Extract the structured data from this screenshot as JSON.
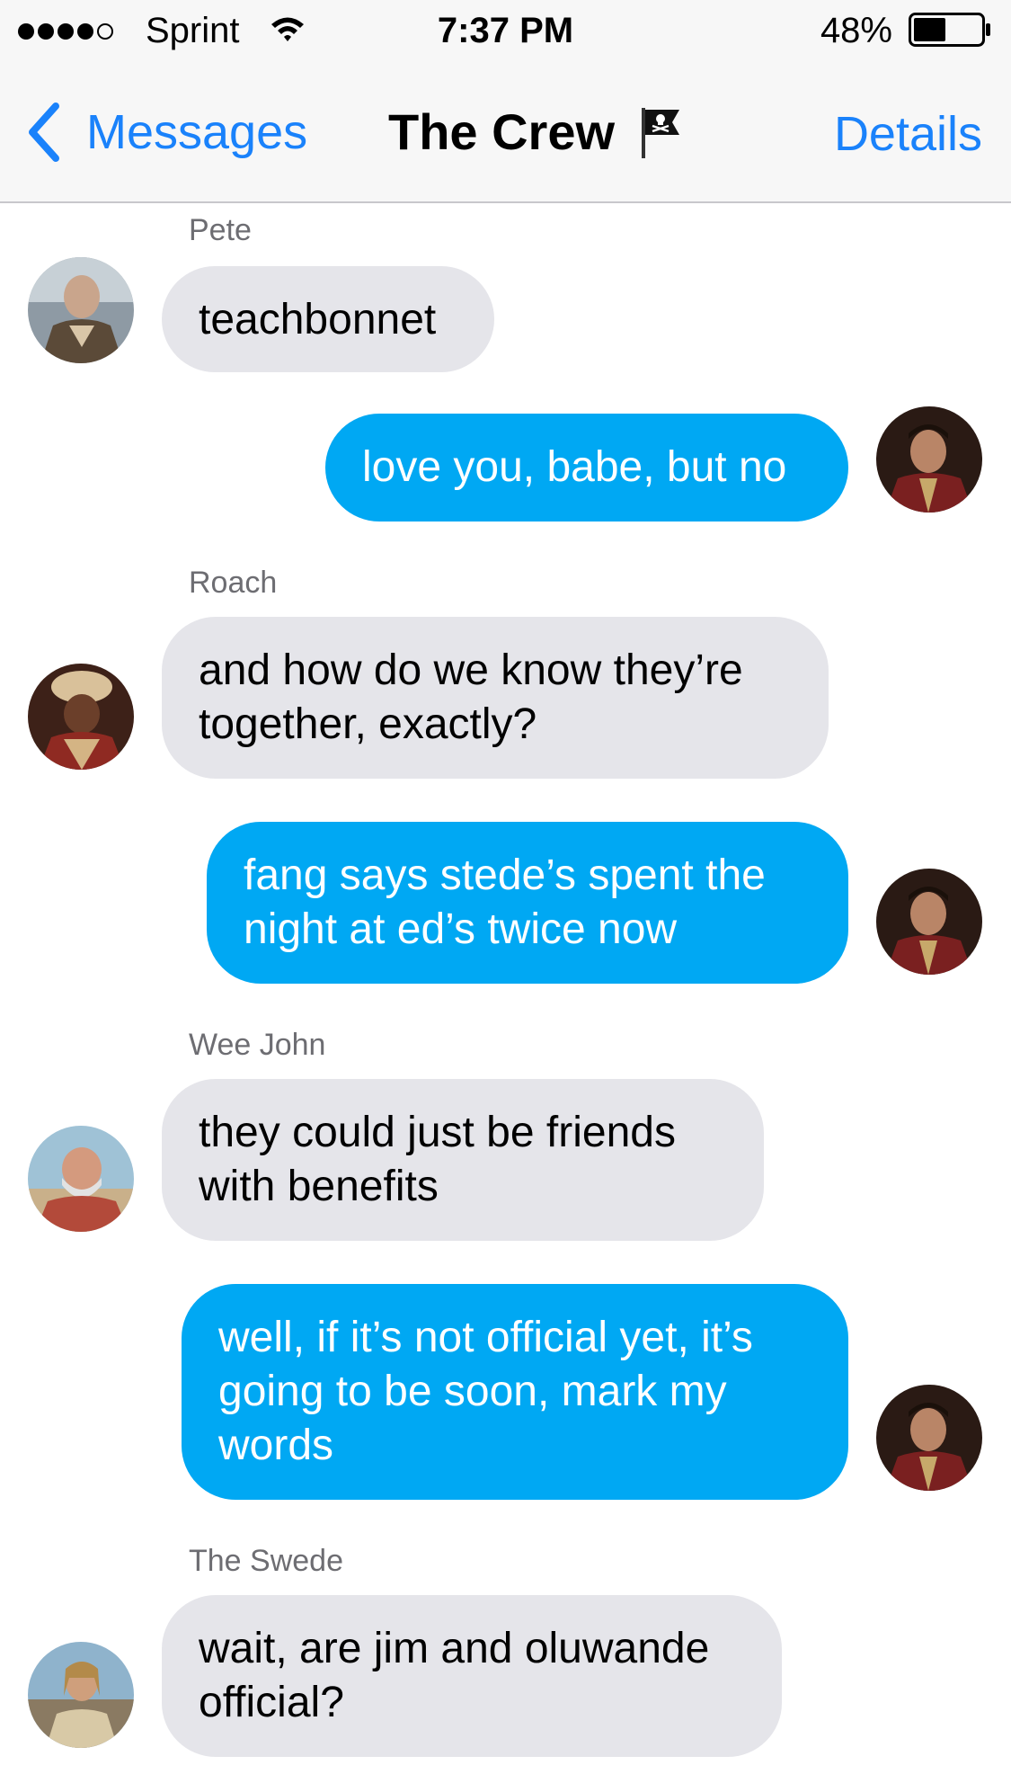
{
  "status_bar": {
    "carrier": "Sprint",
    "time": "7:37 PM",
    "battery": "48%",
    "battery_level": 0.48,
    "signal_bars": 4,
    "signal_total": 5
  },
  "nav": {
    "back_label": "Messages",
    "title": "The Crew",
    "title_icon": "pirate-flag-icon",
    "details_label": "Details"
  },
  "colors": {
    "accent": "#1a82fb",
    "outgoing_bubble": "#00a8f3",
    "incoming_bubble": "#e5e5ea"
  },
  "messages": [
    {
      "sender": "Pete",
      "direction": "in",
      "lines": [
        "teachbonnet"
      ]
    },
    {
      "sender": "",
      "direction": "out",
      "lines": [
        "love you, babe, but no"
      ]
    },
    {
      "sender": "Roach",
      "direction": "in",
      "lines": [
        "and how do we know they’re",
        "together, exactly?"
      ]
    },
    {
      "sender": "",
      "direction": "out",
      "lines": [
        "fang says stede’s spent the",
        "night at ed’s twice now"
      ]
    },
    {
      "sender": "Wee John",
      "direction": "in",
      "lines": [
        "they could just be friends",
        "with benefits"
      ]
    },
    {
      "sender": "",
      "direction": "out",
      "lines": [
        "well, if it’s not official yet, it’s",
        "going to be soon, mark my",
        "words"
      ]
    },
    {
      "sender": "The Swede",
      "direction": "in",
      "lines": [
        "wait, are jim and oluwande",
        "official?"
      ]
    }
  ]
}
